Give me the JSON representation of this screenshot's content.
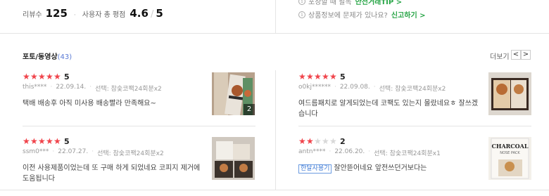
{
  "summary": {
    "review_count_label": "리뷰수",
    "review_count": "125",
    "dot": "·",
    "avg_label": "사용자 총 평점",
    "avg_score": "4.6",
    "slash": "/",
    "max_score": "5"
  },
  "notices": [
    {
      "text": "포장할 때 필독",
      "link": "안전거래TIP >"
    },
    {
      "text": "상품정보에 문제가 있나요?",
      "link": "신고하기 >"
    }
  ],
  "section": {
    "title": "포토/동영상",
    "count": "(43)",
    "more": "더보기",
    "prev": "<",
    "next": ">"
  },
  "reviews": [
    {
      "rating": 5,
      "rating_text": "5",
      "user": "this****",
      "date": "22.09.14.",
      "option": "선택: 참숯코팩24회분x2",
      "badge": "",
      "text": "택배 배송후 아직 미사용 배송빨라 만족해요~",
      "photo_count": "2"
    },
    {
      "rating": 5,
      "rating_text": "5",
      "user": "o0kj******",
      "date": "22.09.08.",
      "option": "선택: 참숯코팩24회분x2",
      "badge": "",
      "text": "여드름패치로 알게되었는데 코팩도 있는지 몰랐네요ㅎ 잘쓰겠습니다",
      "photo_count": ""
    },
    {
      "rating": 5,
      "rating_text": "5",
      "user": "ssm0***",
      "date": "22.07.27.",
      "option": "선택: 참숯코팩24회분x2",
      "badge": "",
      "text": "이전 사용제품이었는데 또 구매 하게 되었네요 코피지 제거에 도움됩니다",
      "photo_count": ""
    },
    {
      "rating": 2,
      "rating_text": "2",
      "user": "antn****",
      "date": "22.06.20.",
      "option": "선택: 참숯코팩24회분x1",
      "badge": "한달사용기",
      "text": "잘안뜯어네요 앞전쓰던거보다는",
      "photo_count": ""
    }
  ],
  "thumb_text": {
    "brand": "CHARCOAL",
    "sub": "NOSE PACK"
  },
  "colors": {
    "star_on": "#f0444b",
    "star_off": "#d8d8d8",
    "link_green": "#27a546",
    "badge_blue": "#3d7ad6"
  }
}
